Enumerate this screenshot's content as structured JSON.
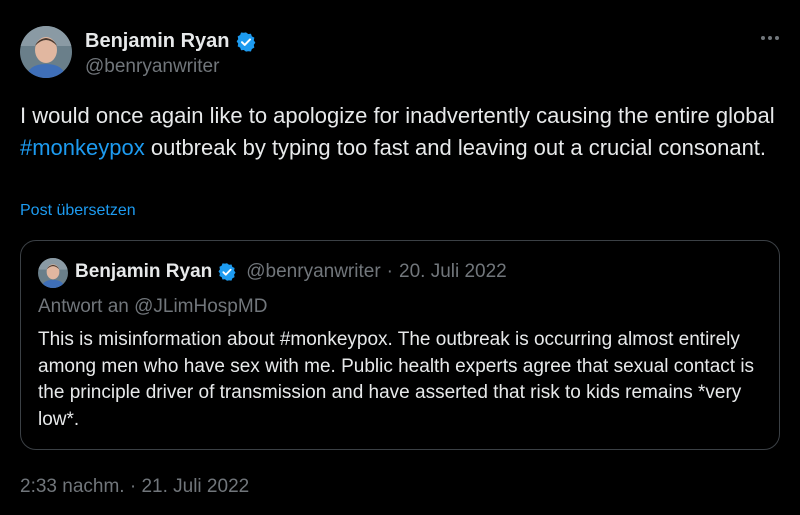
{
  "author": {
    "name": "Benjamin Ryan",
    "handle": "@benryanwriter",
    "verified_icon": "verified-badge-icon"
  },
  "tweet": {
    "text_before": "I would once again like to apologize for inadvertently causing the entire global ",
    "hashtag": "#monkeypox",
    "text_after": " outbreak by typing too fast and leaving out a crucial consonant.",
    "translate_label": "Post übersetzen",
    "timestamp": "2:33 nachm. · 21. Juli 2022"
  },
  "quote": {
    "name": "Benjamin Ryan",
    "handle": "@benryanwriter",
    "separator": "·",
    "date": "20. Juli 2022",
    "reply_to": "Antwort an @JLimHospMD",
    "text": "This is misinformation about #monkeypox. The outbreak is occurring almost entirely among men who have sex with me. Public health experts agree that sexual contact is the principle driver of transmission and have asserted that risk to kids remains *very low*."
  },
  "colors": {
    "background": "#000000",
    "text": "#e7e9ea",
    "secondary": "#71767b",
    "accent": "#1d9bf0",
    "border": "#3b4045"
  }
}
